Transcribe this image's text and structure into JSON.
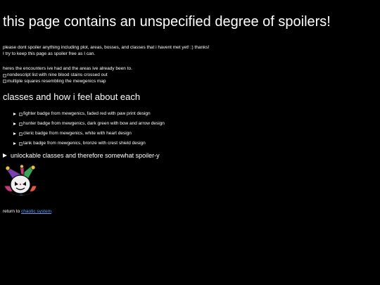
{
  "header": {
    "title": "this page contains an unspecified degree of spoilers!"
  },
  "intro": {
    "line1": "please dont spoiler anything including plot, areas, bosses, and classes that i havent met yet! :) thanks!",
    "line2": "I try to keep this page as spoiler free as I can."
  },
  "encounters": {
    "text": "heres the encounters ive had and the areas ive already been to.",
    "images": [
      {
        "alt": "nondescript list with nine blood stains crossed out",
        "icon": "broken-image-icon"
      },
      {
        "alt": "multiple squares resembling the mewgenics map",
        "icon": "broken-image-icon"
      }
    ]
  },
  "classes": {
    "heading": "classes and how i feel about each",
    "items": [
      {
        "alt": "fighter badge from mewgenics, faded red with paw print design"
      },
      {
        "alt": "hunter badge from mewgenics, dark green with bow and arrow design"
      },
      {
        "alt": "cleric badge from mewgenics, white with heart design"
      },
      {
        "alt": "tank badge from mewgenics, bronze with crest shield design"
      }
    ]
  },
  "unlockables": {
    "label": "unlockable classes and therefore somewhat spoiler-y"
  },
  "footer": {
    "prefix": "return to ",
    "link_text": "chaotic system"
  },
  "colors": {
    "background": "#000000",
    "text": "#ffffff",
    "link": "#4fa3ff"
  }
}
